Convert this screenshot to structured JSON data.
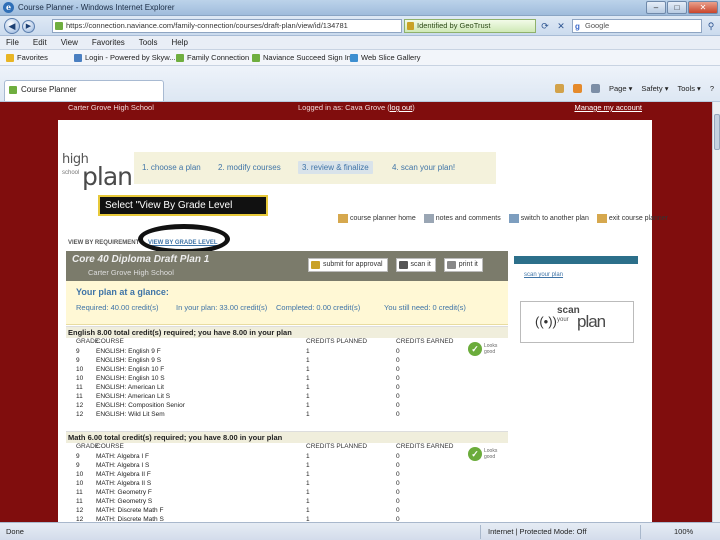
{
  "window": {
    "title": "Course Planner - Windows Internet Explorer",
    "controls": [
      "–",
      "□",
      "✕"
    ]
  },
  "address_bar": {
    "url": "https://connection.naviance.com/family-connection/courses/draft-plan/view/id/134781",
    "cert_label": "Identified by GeoTrust",
    "search_placeholder": "Google"
  },
  "menu": [
    "File",
    "Edit",
    "View",
    "Favorites",
    "Tools",
    "Help"
  ],
  "favorites_bar": [
    {
      "label": "Favorites",
      "color": "#e8b524"
    },
    {
      "label": "Login - Powered by Skyw...",
      "color": "#4a7fc1"
    },
    {
      "label": "Family Connection",
      "color": "#6fae3f"
    },
    {
      "label": "Naviance Succeed Sign In",
      "color": "#6fae3f"
    },
    {
      "label": "Web Slice Gallery",
      "color": "#3d8fd1"
    }
  ],
  "tab": {
    "label": "Course Planner"
  },
  "tab_tools": [
    "Page ▾",
    "Safety ▾",
    "Tools ▾",
    "?"
  ],
  "site_header": {
    "school": "Carter Grove High School",
    "logged_in": "Logged in as: Cava Grove",
    "logout": "log out",
    "manage": "Manage my account"
  },
  "logo": {
    "high": "high",
    "school": "school",
    "plan": "plan"
  },
  "steps": [
    "1. choose a plan",
    "2. modify courses",
    "3. review & finalize",
    "4. scan your plan!"
  ],
  "callout": "Select \"View By Grade Level",
  "top_links": [
    "course planner home",
    "notes and comments",
    "switch to another plan",
    "exit course planner"
  ],
  "view_tabs": {
    "requirement": "VIEW BY REQUIREMENT",
    "grade": "VIEW BY GRADE LEVEL"
  },
  "plan": {
    "title": "Core 40 Diploma Draft Plan 1",
    "subtitle": "Carter Grove High School"
  },
  "plan_actions": [
    "submit for approval",
    "scan it",
    "print it"
  ],
  "glance": {
    "title": "Your plan at a glance:",
    "required": "Required: 40.00 credit(s)",
    "in_plan": "In your plan: 33.00 credit(s)",
    "completed": "Completed: 0.00 credit(s)",
    "still_need": "You still need: 0 credit(s)"
  },
  "sidebar": {
    "link": "scan your plan",
    "scan_word": "scan",
    "your_word": "your",
    "plan_word": "plan"
  },
  "columns": {
    "grade": "GRADE",
    "course": "COURSE",
    "planned": "CREDITS PLANNED",
    "earned": "CREDITS EARNED"
  },
  "badge_text": "Looks good",
  "sections": [
    {
      "title": "English 8.00 total credit(s) required; you have 8.00 in your plan",
      "rows": [
        {
          "grade": "9",
          "course": "ENGLISH: English 9 F",
          "planned": "1",
          "earned": "0"
        },
        {
          "grade": "9",
          "course": "ENGLISH: English 9 S",
          "planned": "1",
          "earned": "0"
        },
        {
          "grade": "10",
          "course": "ENGLISH: English 10 F",
          "planned": "1",
          "earned": "0"
        },
        {
          "grade": "10",
          "course": "ENGLISH: English 10 S",
          "planned": "1",
          "earned": "0"
        },
        {
          "grade": "11",
          "course": "ENGLISH: American Lit",
          "planned": "1",
          "earned": "0"
        },
        {
          "grade": "11",
          "course": "ENGLISH: American Lit S",
          "planned": "1",
          "earned": "0"
        },
        {
          "grade": "12",
          "course": "ENGLISH: Composition Senior",
          "planned": "1",
          "earned": "0"
        },
        {
          "grade": "12",
          "course": "ENGLISH: Wild Lit Sem",
          "planned": "1",
          "earned": "0"
        }
      ]
    },
    {
      "title": "Math 6.00 total credit(s) required; you have 8.00 in your plan",
      "rows": [
        {
          "grade": "9",
          "course": "MATH: Algebra I F",
          "planned": "1",
          "earned": "0"
        },
        {
          "grade": "9",
          "course": "MATH: Algebra I S",
          "planned": "1",
          "earned": "0"
        },
        {
          "grade": "10",
          "course": "MATH: Algebra II F",
          "planned": "1",
          "earned": "0"
        },
        {
          "grade": "10",
          "course": "MATH: Algebra II S",
          "planned": "1",
          "earned": "0"
        },
        {
          "grade": "11",
          "course": "MATH: Geometry F",
          "planned": "1",
          "earned": "0"
        },
        {
          "grade": "11",
          "course": "MATH: Geometry S",
          "planned": "1",
          "earned": "0"
        },
        {
          "grade": "12",
          "course": "MATH: Discrete Math F",
          "planned": "1",
          "earned": "0"
        },
        {
          "grade": "12",
          "course": "MATH: Discrete Math S",
          "planned": "1",
          "earned": "0"
        }
      ]
    }
  ],
  "status": {
    "left": "Done",
    "zone": "Internet | Protected Mode: Off",
    "zoom": "100%"
  }
}
